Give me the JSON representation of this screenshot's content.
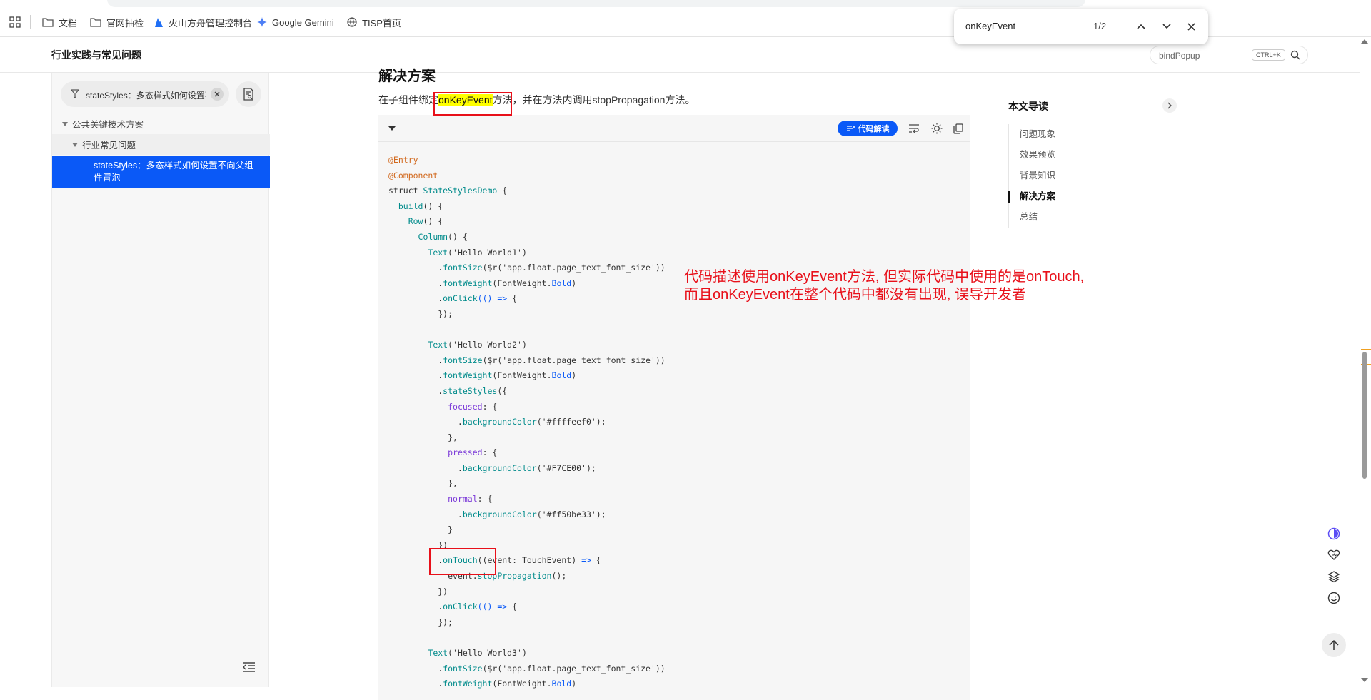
{
  "bookmarks": [
    {
      "label": "文档",
      "icon": "folder-icon"
    },
    {
      "label": "官网抽检",
      "icon": "folder-icon"
    },
    {
      "label": "火山方舟管理控制台",
      "icon": "volcano-logo-icon"
    },
    {
      "label": "Google Gemini",
      "icon": "gemini-star-icon"
    },
    {
      "label": "TISP首页",
      "icon": "globe-icon"
    }
  ],
  "findbar": {
    "query": "onKeyEvent",
    "count": "1/2"
  },
  "header": {
    "title": "行业实践与常见问题",
    "search_placeholder": "bindPopup",
    "shortcut": "CTRL+K"
  },
  "sidebar": {
    "filter_text": "stateStyles：多态样式如何设置不向父组件冒泡",
    "tree": [
      {
        "label": "公共关键技术方案",
        "level": 0
      },
      {
        "label": "行业常见问题",
        "level": 1
      }
    ],
    "selected": "stateStyles：多态样式如何设置不向父组件冒泡"
  },
  "article": {
    "section_title": "解决方案",
    "para_before": "在子组件绑定",
    "para_highlight": "onKeyEvent",
    "para_after": "方法，并在方法内调用stopPropagation方法。",
    "code_ai_label": "代码解读",
    "annotation_line1": "代码描述使用onKeyEvent方法, 但实际代码中使用的是onTouch,",
    "annotation_line2": "而且onKeyEvent在整个代码中都没有出现, 误导开发者"
  },
  "code_lines": [
    [
      [
        "c-ann",
        "@Entry"
      ]
    ],
    [
      [
        "c-ann",
        "@Component"
      ]
    ],
    [
      [
        "c-kw",
        "struct "
      ],
      [
        "c-fn",
        "StateStylesDemo"
      ],
      [
        "c-kw",
        " {"
      ]
    ],
    [
      [
        "c-kw",
        "  "
      ],
      [
        "c-fn",
        "build"
      ],
      [
        "c-kw",
        "() {"
      ]
    ],
    [
      [
        "c-kw",
        "    "
      ],
      [
        "c-fn",
        "Row"
      ],
      [
        "c-kw",
        "() {"
      ]
    ],
    [
      [
        "c-kw",
        "      "
      ],
      [
        "c-fn",
        "Column"
      ],
      [
        "c-kw",
        "() {"
      ]
    ],
    [
      [
        "c-kw",
        "        "
      ],
      [
        "c-fn",
        "Text"
      ],
      [
        "c-str",
        "('Hello World1')"
      ]
    ],
    [
      [
        "c-kw",
        "          ."
      ],
      [
        "c-fn",
        "fontSize"
      ],
      [
        "c-str",
        "($r('app.float.page_text_font_size'))"
      ]
    ],
    [
      [
        "c-kw",
        "          ."
      ],
      [
        "c-fn",
        "fontWeight"
      ],
      [
        "c-kw",
        "(FontWeight."
      ],
      [
        "c-prop",
        "Bold"
      ],
      [
        "c-kw",
        ")"
      ]
    ],
    [
      [
        "c-kw",
        "          ."
      ],
      [
        "c-fn",
        "onClick"
      ],
      [
        "c-prop",
        "(() =>"
      ],
      [
        "c-kw",
        " {"
      ]
    ],
    [
      [
        "c-kw",
        "          });"
      ]
    ],
    [
      [
        "c-kw",
        ""
      ]
    ],
    [
      [
        "c-kw",
        "        "
      ],
      [
        "c-fn",
        "Text"
      ],
      [
        "c-str",
        "('Hello World2')"
      ]
    ],
    [
      [
        "c-kw",
        "          ."
      ],
      [
        "c-fn",
        "fontSize"
      ],
      [
        "c-str",
        "($r('app.float.page_text_font_size'))"
      ]
    ],
    [
      [
        "c-kw",
        "          ."
      ],
      [
        "c-fn",
        "fontWeight"
      ],
      [
        "c-kw",
        "(FontWeight."
      ],
      [
        "c-prop",
        "Bold"
      ],
      [
        "c-kw",
        ")"
      ]
    ],
    [
      [
        "c-kw",
        "          ."
      ],
      [
        "c-fn",
        "stateStyles"
      ],
      [
        "c-kw",
        "({"
      ]
    ],
    [
      [
        "c-kw",
        "            "
      ],
      [
        "c-key",
        "focused"
      ],
      [
        "c-kw",
        ": {"
      ]
    ],
    [
      [
        "c-kw",
        "              ."
      ],
      [
        "c-fn",
        "backgroundColor"
      ],
      [
        "c-str",
        "('#ffffeef0');"
      ]
    ],
    [
      [
        "c-kw",
        "            },"
      ]
    ],
    [
      [
        "c-kw",
        "            "
      ],
      [
        "c-key",
        "pressed"
      ],
      [
        "c-kw",
        ": {"
      ]
    ],
    [
      [
        "c-kw",
        "              ."
      ],
      [
        "c-fn",
        "backgroundColor"
      ],
      [
        "c-str",
        "('#F7CE00');"
      ]
    ],
    [
      [
        "c-kw",
        "            },"
      ]
    ],
    [
      [
        "c-kw",
        "            "
      ],
      [
        "c-key",
        "normal"
      ],
      [
        "c-kw",
        ": {"
      ]
    ],
    [
      [
        "c-kw",
        "              ."
      ],
      [
        "c-fn",
        "backgroundColor"
      ],
      [
        "c-str",
        "('#ff50be33');"
      ]
    ],
    [
      [
        "c-kw",
        "            }"
      ]
    ],
    [
      [
        "c-kw",
        "          })"
      ]
    ],
    [
      [
        "c-kw",
        "          ."
      ],
      [
        "c-fn",
        "onTouch"
      ],
      [
        "c-kw",
        "(("
      ],
      [
        "c-kw",
        "event: TouchEvent) "
      ],
      [
        "c-prop",
        "=>"
      ],
      [
        "c-kw",
        " {"
      ]
    ],
    [
      [
        "c-kw",
        "            event."
      ],
      [
        "c-fn",
        "stopPropagation"
      ],
      [
        "c-kw",
        "();"
      ]
    ],
    [
      [
        "c-kw",
        "          })"
      ]
    ],
    [
      [
        "c-kw",
        "          ."
      ],
      [
        "c-fn",
        "onClick"
      ],
      [
        "c-prop",
        "(() =>"
      ],
      [
        "c-kw",
        " {"
      ]
    ],
    [
      [
        "c-kw",
        "          });"
      ]
    ],
    [
      [
        "c-kw",
        ""
      ]
    ],
    [
      [
        "c-kw",
        "        "
      ],
      [
        "c-fn",
        "Text"
      ],
      [
        "c-str",
        "('Hello World3')"
      ]
    ],
    [
      [
        "c-kw",
        "          ."
      ],
      [
        "c-fn",
        "fontSize"
      ],
      [
        "c-str",
        "($r('app.float.page_text_font_size'))"
      ]
    ],
    [
      [
        "c-kw",
        "          ."
      ],
      [
        "c-fn",
        "fontWeight"
      ],
      [
        "c-kw",
        "(FontWeight."
      ],
      [
        "c-prop",
        "Bold"
      ],
      [
        "c-kw",
        ")"
      ]
    ]
  ],
  "toc": {
    "title": "本文导读",
    "items": [
      "问题现象",
      "效果预览",
      "背景知识",
      "解决方案",
      "总结"
    ],
    "active": "解决方案"
  },
  "colors": {
    "accent": "#0a59f7",
    "annotation": "#e8101a",
    "highlight": "#ffff00"
  }
}
